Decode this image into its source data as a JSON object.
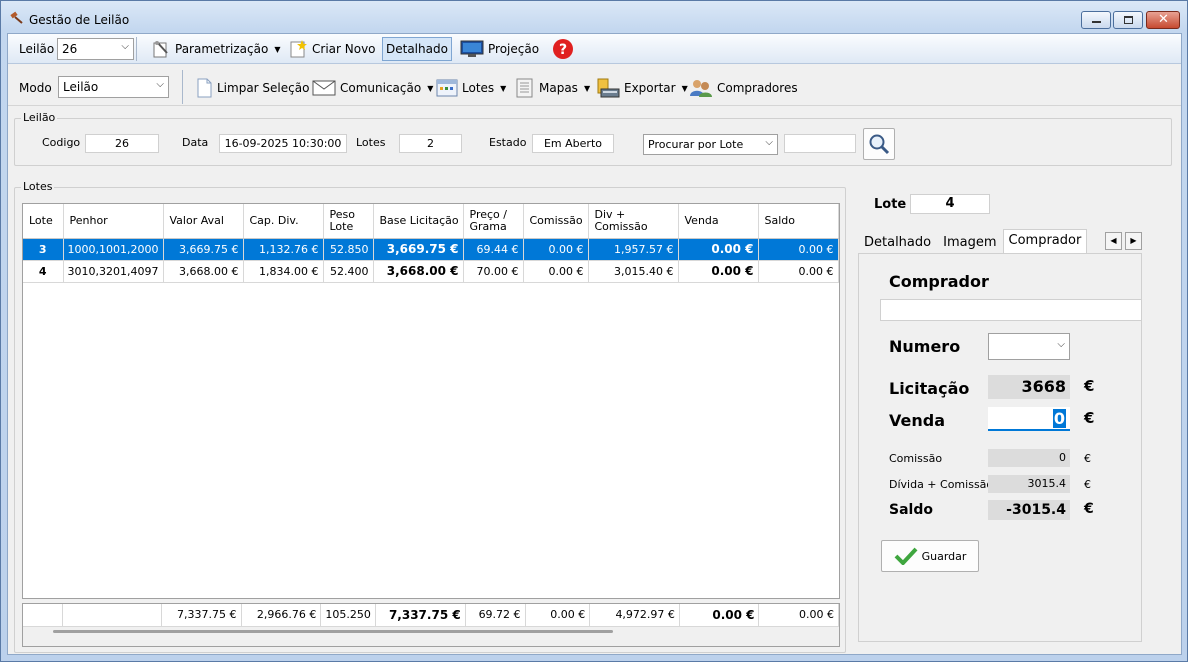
{
  "window": {
    "title": "Gestão de Leilão"
  },
  "toolbar1": {
    "leilao_label": "Leilão",
    "leilao_value": "26",
    "parametrizacao": "Parametrização",
    "criar_novo": "Criar Novo",
    "detalhado": "Detalhado",
    "projecao": "Projeção"
  },
  "toolbar2": {
    "modo_label": "Modo",
    "modo_value": "Leilão",
    "limpar_selecao": "Limpar Seleção",
    "comunicacao": "Comunicação",
    "lotes": "Lotes",
    "mapas": "Mapas",
    "exportar": "Exportar",
    "compradores": "Compradores"
  },
  "leilao_group": {
    "title": "Leilão",
    "codigo_label": "Codigo",
    "codigo_value": "26",
    "data_label": "Data",
    "data_value": "16-09-2025 10:30:00",
    "lotes_label": "Lotes",
    "lotes_value": "2",
    "estado_label": "Estado",
    "estado_value": "Em Aberto",
    "search_mode": "Procurar por Lote",
    "search_value": ""
  },
  "lotes_group": {
    "title": "Lotes",
    "columns": [
      "Lote",
      "Penhor",
      "Valor Aval",
      "Cap. Div.",
      "Peso Lote",
      "Base Licitação",
      "Preço / Grama",
      "Comissão",
      "Div + Comissão",
      "Venda",
      "Saldo"
    ],
    "rows": [
      {
        "lote": "3",
        "penhor": "1000,1001,2000",
        "valor_aval": "3,669.75 €",
        "cap_div": "1,132.76 €",
        "peso": "52.850",
        "base": "3,669.75 €",
        "preco": "69.44 €",
        "comissao": "0.00 €",
        "div_com": "1,957.57 €",
        "venda": "0.00 €",
        "saldo": "0.00 €"
      },
      {
        "lote": "4",
        "penhor": "3010,3201,4097",
        "valor_aval": "3,668.00 €",
        "cap_div": "1,834.00 €",
        "peso": "52.400",
        "base": "3,668.00 €",
        "preco": "70.00 €",
        "comissao": "0.00 €",
        "div_com": "3,015.40 €",
        "venda": "0.00 €",
        "saldo": "0.00 €"
      }
    ],
    "totals": {
      "valor_aval": "7,337.75 €",
      "cap_div": "2,966.76 €",
      "peso": "105.250",
      "base": "7,337.75 €",
      "preco": "69.72 €",
      "comissao": "0.00 €",
      "div_com": "4,972.97 €",
      "venda": "0.00 €",
      "saldo": "0.00 €"
    }
  },
  "right_panel": {
    "lote_label": "Lote",
    "lote_value": "4",
    "tabs": [
      "Detalhado",
      "Imagem",
      "Comprador"
    ],
    "comprador_title": "Comprador",
    "comprador_value": "",
    "numero_label": "Numero",
    "numero_value": "",
    "licitacao_label": "Licitação",
    "licitacao_value": "3668",
    "venda_label": "Venda",
    "venda_value": "0",
    "euro": "€",
    "comissao_label": "Comissão",
    "comissao_value": "0",
    "divida_label": "Dívida + Comissão",
    "divida_value": "3015.4",
    "saldo_label": "Saldo",
    "saldo_value": "-3015.4",
    "guardar": "Guardar"
  }
}
